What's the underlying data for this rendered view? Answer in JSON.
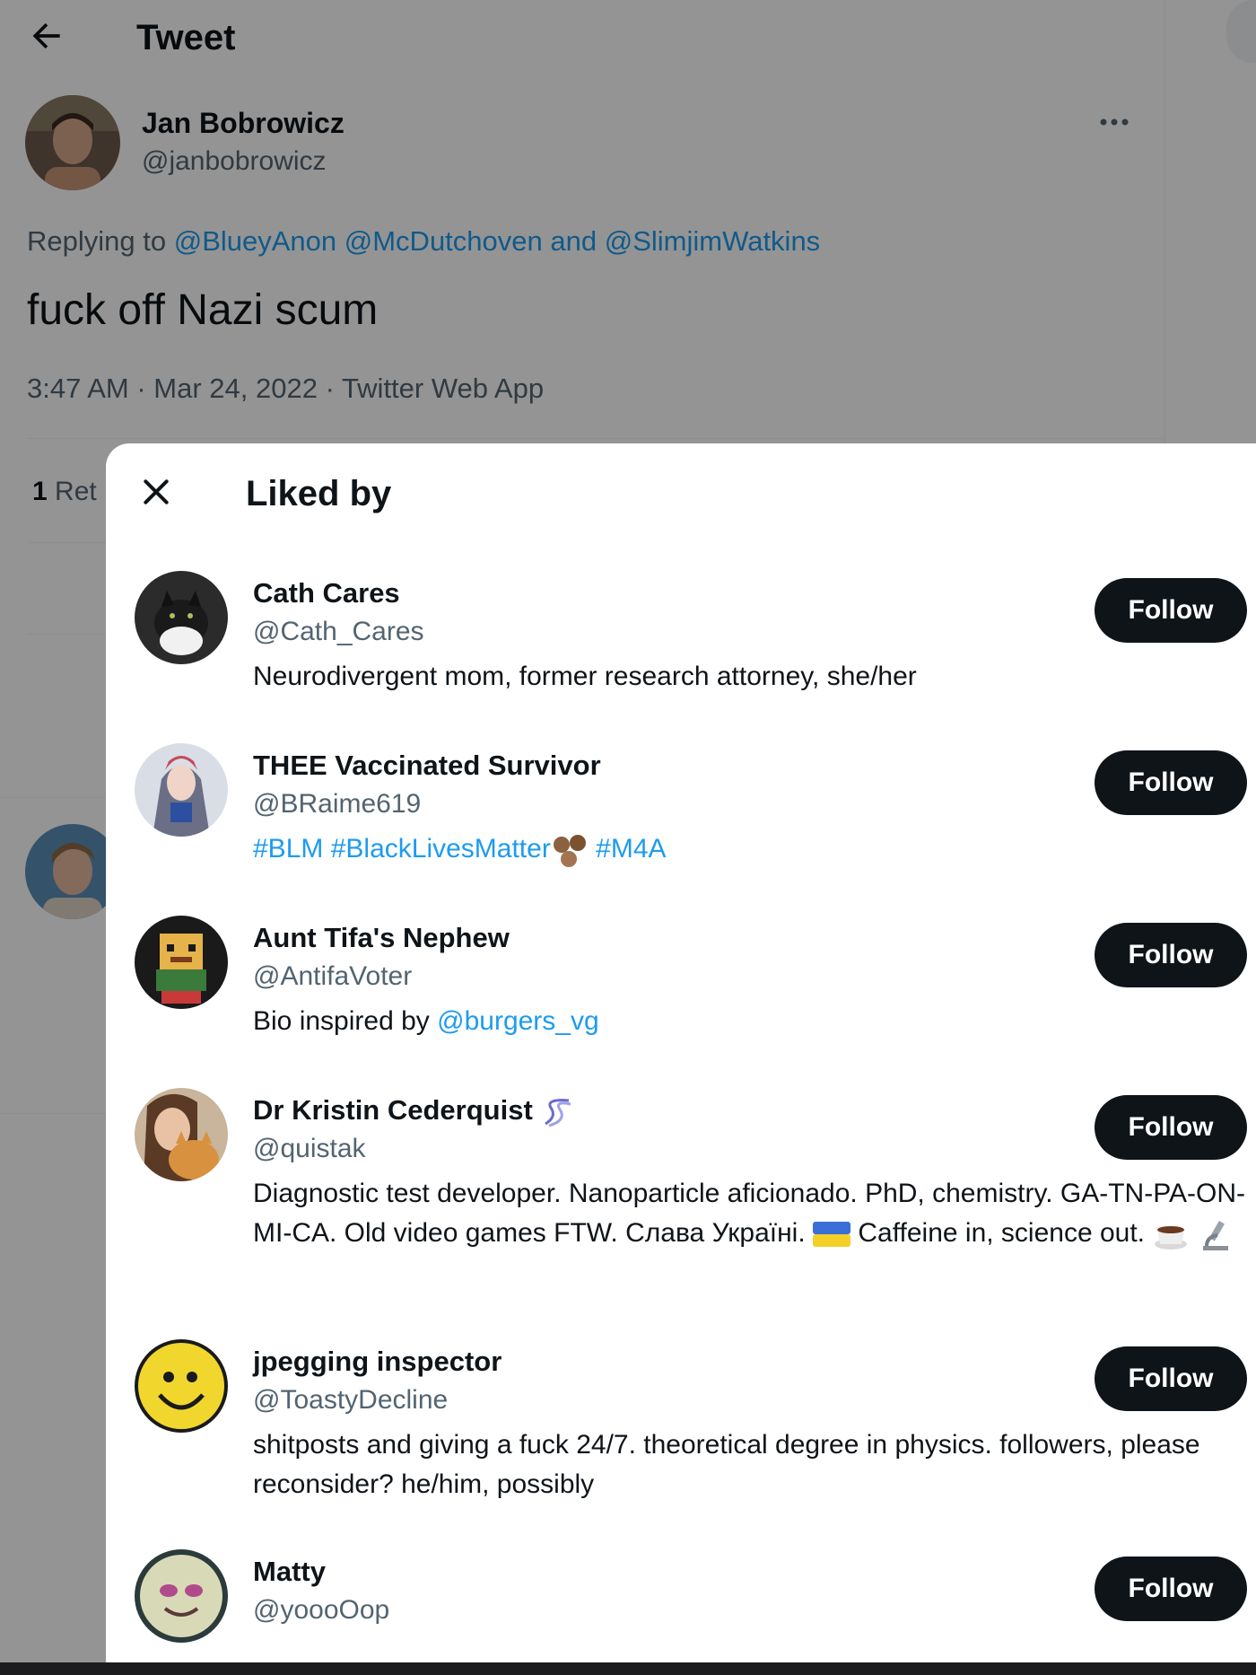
{
  "header": {
    "title": "Tweet"
  },
  "tweet": {
    "author_name": "Jan Bobrowicz",
    "author_handle": "@janbobrowicz",
    "replying_label": "Replying to",
    "mention_1": "@BlueyAnon",
    "mention_2": "@McDutchoven",
    "and_label": "and",
    "mention_3": "@SlimjimWatkins",
    "text": "fuck off Nazi scum",
    "meta": "3:47 AM · Mar 24, 2022 · Twitter Web App",
    "retweet_count": "1",
    "retweet_label_partial": "Ret"
  },
  "modal": {
    "title": "Liked by",
    "follow_label": "Follow",
    "users": [
      {
        "name": "Cath Cares",
        "handle": "@Cath_Cares",
        "bio": "Neurodivergent mom, former research attorney, she/her"
      },
      {
        "name": "THEE Vaccinated Survivor",
        "handle": "@BRaime619",
        "bio_tags": [
          "#BLM",
          "#BlackLivesMatter",
          "#M4A"
        ]
      },
      {
        "name": "Aunt Tifa's Nephew",
        "handle": "@AntifaVoter",
        "bio_text": "Bio inspired by",
        "bio_link": "@burgers_vg"
      },
      {
        "name": "Dr Kristin Cederquist",
        "handle": "@quistak",
        "bio_part1": "Diagnostic test developer. Nanoparticle aficionado. PhD, chemistry. GA-TN-PA-ON-MI-CA. Old video games FTW. Слава Україні.",
        "bio_part2": "Caffeine in, science out."
      },
      {
        "name": "jpegging inspector",
        "handle": "@ToastyDecline",
        "bio": "shitposts and giving a fuck 24/7. theoretical degree in physics. followers, please reconsider? he/him, possibly"
      },
      {
        "name": "Matty",
        "handle": "@yoooOop"
      }
    ]
  },
  "colors": {
    "accent": "#1d9bf0",
    "button_bg": "#0f1419",
    "secondary_text": "#536471"
  },
  "icons": [
    "back-arrow-icon",
    "more-icon",
    "close-icon",
    "dna-icon",
    "ukraine-flag-icon",
    "coffee-icon",
    "microscope-icon",
    "brown-hearts-emoji"
  ]
}
